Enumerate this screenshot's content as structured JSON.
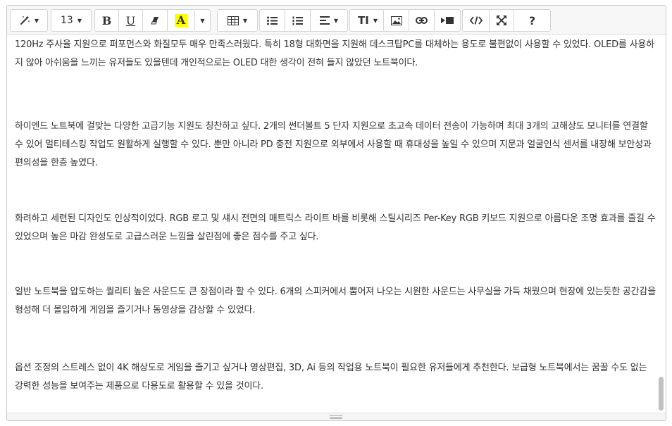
{
  "toolbar": {
    "font_size": "13",
    "bold_label": "B",
    "underline_label": "U",
    "font_color_label": "A",
    "font_color": "#ffff00",
    "text_size_label": "TI",
    "help_label": "?",
    "icons": [
      "magic-wand-icon",
      "eraser-icon",
      "table-icon",
      "unordered-list-icon",
      "ordered-list-icon",
      "align-icon",
      "picture-icon",
      "link-icon",
      "video-icon",
      "code-view-icon",
      "fullscreen-icon"
    ]
  },
  "content": {
    "paragraphs": [
      "120Hz 주사율 지원으로 퍼포먼스와 화질모두 매우 만족스러웠다. 특히 18형 대화면을 지원해 데스크탑PC를 대체하는 용도로 불편없이 사용할 수 있었다. OLED를 사용하지 않아 아쉬움을 느끼는 유저들도 있을텐데 개인적으로는 OLED 대한 생각이 전혀 들지 않았던 노트북이다.",
      "하이엔드 노트북에 걸맞는 다양한 고급기능 지원도 칭찬하고 싶다. 2개의 썬더볼트 5 단자 지원으로 초고속 데이터 전송이 가능하며 최대 3개의 고해상도 모니터를 연결할 수 있어 멀티테스킹 작업도 원활하게 실행할 수 있다. 뿐만 아니라 PD 충전 지원으로 외부에서 사용할 때 휴대성을 높일 수 있으며 지문과 얼굴인식 센서를 내장해 보안성과 편의성을 한층 높였다.",
      "화려하고 세련된 디자인도 인상적이었다. RGB 로고 및 섀시 전면의 매트릭스 라이트 바를 비롯해 스틸시리즈 Per-Key RGB 키보드 지원으로 아름다운 조명 효과를 즐길 수 있었으며 높은 마감 완성도로 고급스러운 느낌을 살린점에 좋은 점수를 주고 싶다.",
      "일반 노트북을 압도하는 퀄리티 높은 사운드도 큰 장점이라 할 수 있다. 6개의 스피커에서 뿜어져 나오는 시원한 사운드는 사무실을 가득 채웠으며 현장에 있는듯한 공간감을 형성해 더 몰입하게 게임을 즐기거나 동영상을 감상할 수 있었다.",
      "옵션 조정의 스트레스 없이 4K 해상도로 게임을 즐기고 싶거나 영상편집, 3D, Ai 등의 작업용 노트북이 필요한 유저들에게 추천한다. 보급형 노트북에서는 꿈꿀 수도 없는 강력한 성능을 보여주는 제품으로 다용도로 활용할 수 있을 것이다."
    ]
  }
}
